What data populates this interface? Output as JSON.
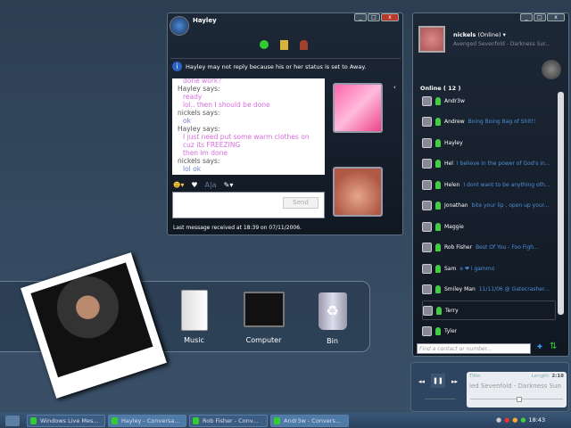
{
  "conversation": {
    "contact_name": "Hayley",
    "away_notice": "Hayley may not reply because his or her status is set to Away.",
    "messages": [
      {
        "sender": "Hayley says:",
        "lines": [
          "ready",
          "lol.. then I should be done"
        ]
      },
      {
        "sender": "nickels says:",
        "lines": [
          "ok"
        ]
      },
      {
        "sender": "Hayley says:",
        "lines": [
          "I just need put some warm clothes on cuz its FREEZING",
          "then im done"
        ]
      },
      {
        "sender": "nickels says:",
        "lines": [
          "lol ok"
        ]
      }
    ],
    "send_label": "Send",
    "status_bar": "Last message received at 18:39 on 07/11/2006."
  },
  "messenger": {
    "user_name": "nickels",
    "status": "(Online)",
    "now_playing": "Avenged Sevenfold - Darkness Sur...",
    "group_header": "Online ( 12 )",
    "contacts": [
      {
        "name": "Andr3w",
        "msg": ""
      },
      {
        "name": "Andrew",
        "msg": "Boing Boing Bag of Shit!!"
      },
      {
        "name": "Hayley",
        "msg": ""
      },
      {
        "name": "Hel",
        "msg": "I believe in the power of God's in..."
      },
      {
        "name": "Helen",
        "msg": "I dont want to be anything oth..."
      },
      {
        "name": "Jonathan",
        "msg": "bite your lip , open up your..."
      },
      {
        "name": "Maggie",
        "msg": ""
      },
      {
        "name": "Rob Fisher",
        "msg": "Best Of You - Foo Figh..."
      },
      {
        "name": "Sam",
        "msg": "e ❤ i gammo"
      },
      {
        "name": "Smiley Man",
        "msg": "11/11/06 @ Gatecrasher..."
      },
      {
        "name": "Terry",
        "msg": ""
      },
      {
        "name": "Tyler",
        "msg": ""
      }
    ],
    "search_placeholder": "Find a contact or number..."
  },
  "dock": {
    "items": [
      {
        "label": "Music"
      },
      {
        "label": "Computer"
      },
      {
        "label": "Bin"
      }
    ]
  },
  "player": {
    "title_label": "Title:",
    "length_label": "Length:",
    "length": "2:18",
    "track": "ied Sevenfold - Darkness Sun",
    "position": 0.5
  },
  "taskbar": {
    "items": [
      "Windows Live Mes...",
      "Hayley - Conversa...",
      "Rob Fisher - Conv...",
      "Andr3w - Convers..."
    ],
    "clock": "18:43"
  }
}
